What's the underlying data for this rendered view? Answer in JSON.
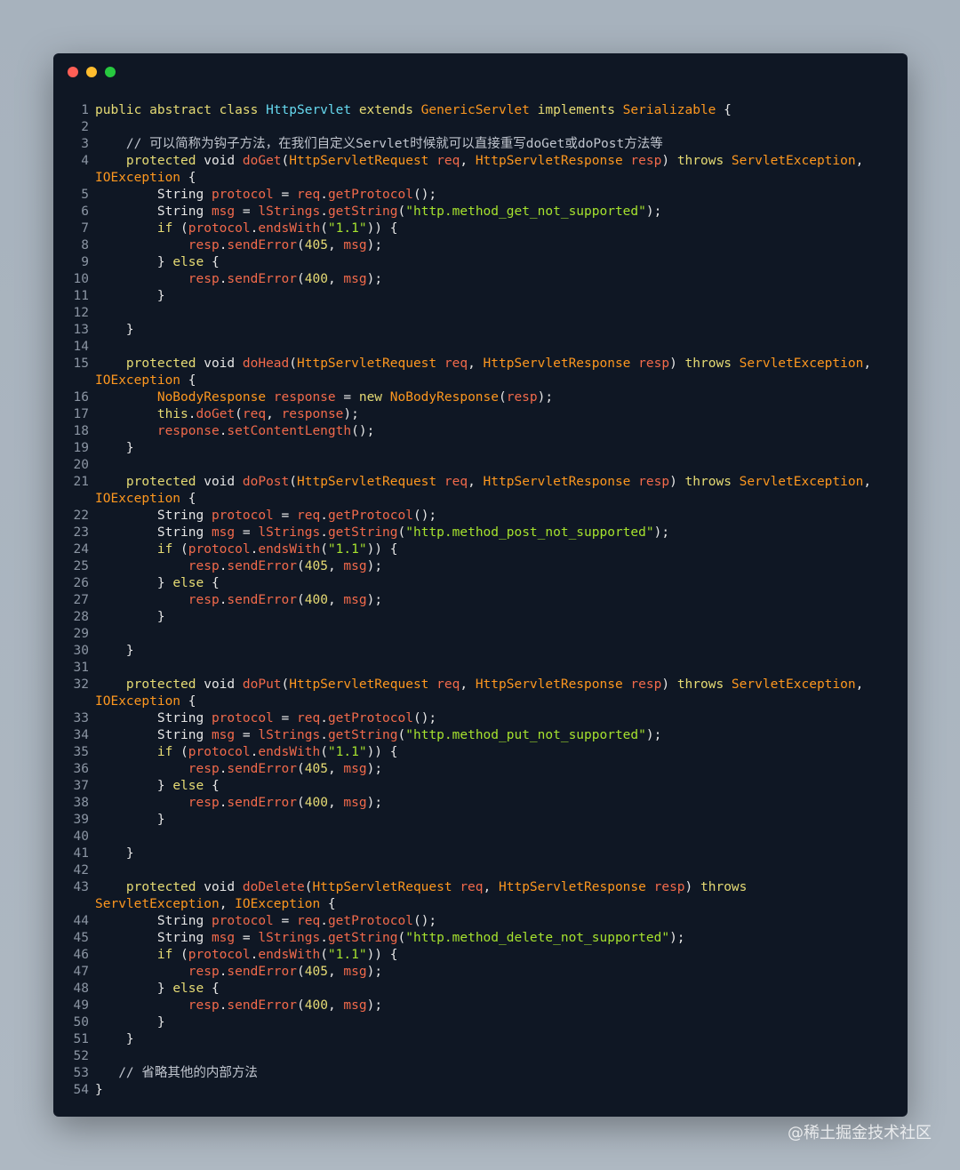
{
  "window": {
    "controls": [
      {
        "name": "close",
        "color": "#ff5f56"
      },
      {
        "name": "minimize",
        "color": "#ffbd2e"
      },
      {
        "name": "maximize",
        "color": "#27c93f"
      }
    ]
  },
  "watermark": "@稀土掘金技术社区",
  "colors": {
    "keyword": "#e6db74",
    "type": "#fd971f",
    "class": "#66d9ef",
    "identifier": "#f26a4b",
    "string": "#a6e22e",
    "comment": "#c0c5ce",
    "background": "#0f1724"
  },
  "lines": [
    {
      "n": "1",
      "t": [
        [
          "kw",
          "public abstract class "
        ],
        [
          "cls",
          "HttpServlet "
        ],
        [
          "kw",
          "extends "
        ],
        [
          "ty",
          "GenericServlet "
        ],
        [
          "kw",
          "implements "
        ],
        [
          "ty",
          "Serializable "
        ],
        [
          "pl",
          "{"
        ]
      ]
    },
    {
      "n": "2",
      "t": []
    },
    {
      "n": "3",
      "t": [
        [
          "cm",
          "    // 可以简称为钩子方法，在我们自定义Servlet时候就可以直接重写doGet或doPost方法等"
        ]
      ]
    },
    {
      "n": "4",
      "t": [
        [
          "kw",
          "    protected "
        ],
        [
          "pl",
          "void "
        ],
        [
          "fn",
          "doGet"
        ],
        [
          "pl",
          "("
        ],
        [
          "ty",
          "HttpServletRequest "
        ],
        [
          "var",
          "req"
        ],
        [
          "pl",
          ", "
        ],
        [
          "ty",
          "HttpServletResponse "
        ],
        [
          "var",
          "resp"
        ],
        [
          "pl",
          ") "
        ],
        [
          "kw",
          "throws "
        ],
        [
          "ty",
          "ServletException"
        ],
        [
          "pl",
          ","
        ]
      ]
    },
    {
      "n": "",
      "t": [
        [
          "ty",
          "IOException "
        ],
        [
          "pl",
          "{"
        ]
      ]
    },
    {
      "n": "5",
      "t": [
        [
          "pl",
          "        String "
        ],
        [
          "var",
          "protocol"
        ],
        [
          "pl",
          " = "
        ],
        [
          "var",
          "req"
        ],
        [
          "pl",
          "."
        ],
        [
          "fn",
          "getProtocol"
        ],
        [
          "pl",
          "();"
        ]
      ]
    },
    {
      "n": "6",
      "t": [
        [
          "pl",
          "        String "
        ],
        [
          "var",
          "msg"
        ],
        [
          "pl",
          " = "
        ],
        [
          "var",
          "lStrings"
        ],
        [
          "pl",
          "."
        ],
        [
          "fn",
          "getString"
        ],
        [
          "pl",
          "("
        ],
        [
          "str",
          "\"http.method_get_not_supported\""
        ],
        [
          "pl",
          ");"
        ]
      ]
    },
    {
      "n": "7",
      "t": [
        [
          "kw",
          "        if "
        ],
        [
          "pl",
          "("
        ],
        [
          "var",
          "protocol"
        ],
        [
          "pl",
          "."
        ],
        [
          "fn",
          "endsWith"
        ],
        [
          "pl",
          "("
        ],
        [
          "str",
          "\"1.1\""
        ],
        [
          "pl",
          ")) {"
        ]
      ]
    },
    {
      "n": "8",
      "t": [
        [
          "var",
          "            resp"
        ],
        [
          "pl",
          "."
        ],
        [
          "fn",
          "sendError"
        ],
        [
          "pl",
          "("
        ],
        [
          "num",
          "405"
        ],
        [
          "pl",
          ", "
        ],
        [
          "var",
          "msg"
        ],
        [
          "pl",
          ");"
        ]
      ]
    },
    {
      "n": "9",
      "t": [
        [
          "pl",
          "        } "
        ],
        [
          "kw",
          "else "
        ],
        [
          "pl",
          "{"
        ]
      ]
    },
    {
      "n": "10",
      "t": [
        [
          "var",
          "            resp"
        ],
        [
          "pl",
          "."
        ],
        [
          "fn",
          "sendError"
        ],
        [
          "pl",
          "("
        ],
        [
          "num",
          "400"
        ],
        [
          "pl",
          ", "
        ],
        [
          "var",
          "msg"
        ],
        [
          "pl",
          ");"
        ]
      ]
    },
    {
      "n": "11",
      "t": [
        [
          "pl",
          "        }"
        ]
      ]
    },
    {
      "n": "12",
      "t": []
    },
    {
      "n": "13",
      "t": [
        [
          "pl",
          "    }"
        ]
      ]
    },
    {
      "n": "14",
      "t": []
    },
    {
      "n": "15",
      "t": [
        [
          "kw",
          "    protected "
        ],
        [
          "pl",
          "void "
        ],
        [
          "fn",
          "doHead"
        ],
        [
          "pl",
          "("
        ],
        [
          "ty",
          "HttpServletRequest "
        ],
        [
          "var",
          "req"
        ],
        [
          "pl",
          ", "
        ],
        [
          "ty",
          "HttpServletResponse "
        ],
        [
          "var",
          "resp"
        ],
        [
          "pl",
          ") "
        ],
        [
          "kw",
          "throws "
        ],
        [
          "ty",
          "ServletException"
        ],
        [
          "pl",
          ","
        ]
      ]
    },
    {
      "n": "",
      "t": [
        [
          "ty",
          "IOException "
        ],
        [
          "pl",
          "{"
        ]
      ]
    },
    {
      "n": "16",
      "t": [
        [
          "ty",
          "        NoBodyResponse "
        ],
        [
          "var",
          "response"
        ],
        [
          "pl",
          " = "
        ],
        [
          "kw",
          "new "
        ],
        [
          "ty",
          "NoBodyResponse"
        ],
        [
          "pl",
          "("
        ],
        [
          "var",
          "resp"
        ],
        [
          "pl",
          ");"
        ]
      ]
    },
    {
      "n": "17",
      "t": [
        [
          "kw",
          "        this"
        ],
        [
          "pl",
          "."
        ],
        [
          "fn",
          "doGet"
        ],
        [
          "pl",
          "("
        ],
        [
          "var",
          "req"
        ],
        [
          "pl",
          ", "
        ],
        [
          "var",
          "response"
        ],
        [
          "pl",
          ");"
        ]
      ]
    },
    {
      "n": "18",
      "t": [
        [
          "var",
          "        response"
        ],
        [
          "pl",
          "."
        ],
        [
          "fn",
          "setContentLength"
        ],
        [
          "pl",
          "();"
        ]
      ]
    },
    {
      "n": "19",
      "t": [
        [
          "pl",
          "    }"
        ]
      ]
    },
    {
      "n": "20",
      "t": []
    },
    {
      "n": "21",
      "t": [
        [
          "kw",
          "    protected "
        ],
        [
          "pl",
          "void "
        ],
        [
          "fn",
          "doPost"
        ],
        [
          "pl",
          "("
        ],
        [
          "ty",
          "HttpServletRequest "
        ],
        [
          "var",
          "req"
        ],
        [
          "pl",
          ", "
        ],
        [
          "ty",
          "HttpServletResponse "
        ],
        [
          "var",
          "resp"
        ],
        [
          "pl",
          ") "
        ],
        [
          "kw",
          "throws "
        ],
        [
          "ty",
          "ServletException"
        ],
        [
          "pl",
          ","
        ]
      ]
    },
    {
      "n": "",
      "t": [
        [
          "ty",
          "IOException "
        ],
        [
          "pl",
          "{"
        ]
      ]
    },
    {
      "n": "22",
      "t": [
        [
          "pl",
          "        String "
        ],
        [
          "var",
          "protocol"
        ],
        [
          "pl",
          " = "
        ],
        [
          "var",
          "req"
        ],
        [
          "pl",
          "."
        ],
        [
          "fn",
          "getProtocol"
        ],
        [
          "pl",
          "();"
        ]
      ]
    },
    {
      "n": "23",
      "t": [
        [
          "pl",
          "        String "
        ],
        [
          "var",
          "msg"
        ],
        [
          "pl",
          " = "
        ],
        [
          "var",
          "lStrings"
        ],
        [
          "pl",
          "."
        ],
        [
          "fn",
          "getString"
        ],
        [
          "pl",
          "("
        ],
        [
          "str",
          "\"http.method_post_not_supported\""
        ],
        [
          "pl",
          ");"
        ]
      ]
    },
    {
      "n": "24",
      "t": [
        [
          "kw",
          "        if "
        ],
        [
          "pl",
          "("
        ],
        [
          "var",
          "protocol"
        ],
        [
          "pl",
          "."
        ],
        [
          "fn",
          "endsWith"
        ],
        [
          "pl",
          "("
        ],
        [
          "str",
          "\"1.1\""
        ],
        [
          "pl",
          ")) {"
        ]
      ]
    },
    {
      "n": "25",
      "t": [
        [
          "var",
          "            resp"
        ],
        [
          "pl",
          "."
        ],
        [
          "fn",
          "sendError"
        ],
        [
          "pl",
          "("
        ],
        [
          "num",
          "405"
        ],
        [
          "pl",
          ", "
        ],
        [
          "var",
          "msg"
        ],
        [
          "pl",
          ");"
        ]
      ]
    },
    {
      "n": "26",
      "t": [
        [
          "pl",
          "        } "
        ],
        [
          "kw",
          "else "
        ],
        [
          "pl",
          "{"
        ]
      ]
    },
    {
      "n": "27",
      "t": [
        [
          "var",
          "            resp"
        ],
        [
          "pl",
          "."
        ],
        [
          "fn",
          "sendError"
        ],
        [
          "pl",
          "("
        ],
        [
          "num",
          "400"
        ],
        [
          "pl",
          ", "
        ],
        [
          "var",
          "msg"
        ],
        [
          "pl",
          ");"
        ]
      ]
    },
    {
      "n": "28",
      "t": [
        [
          "pl",
          "        }"
        ]
      ]
    },
    {
      "n": "29",
      "t": []
    },
    {
      "n": "30",
      "t": [
        [
          "pl",
          "    }"
        ]
      ]
    },
    {
      "n": "31",
      "t": []
    },
    {
      "n": "32",
      "t": [
        [
          "kw",
          "    protected "
        ],
        [
          "pl",
          "void "
        ],
        [
          "fn",
          "doPut"
        ],
        [
          "pl",
          "("
        ],
        [
          "ty",
          "HttpServletRequest "
        ],
        [
          "var",
          "req"
        ],
        [
          "pl",
          ", "
        ],
        [
          "ty",
          "HttpServletResponse "
        ],
        [
          "var",
          "resp"
        ],
        [
          "pl",
          ") "
        ],
        [
          "kw",
          "throws "
        ],
        [
          "ty",
          "ServletException"
        ],
        [
          "pl",
          ","
        ]
      ]
    },
    {
      "n": "",
      "t": [
        [
          "ty",
          "IOException "
        ],
        [
          "pl",
          "{"
        ]
      ]
    },
    {
      "n": "33",
      "t": [
        [
          "pl",
          "        String "
        ],
        [
          "var",
          "protocol"
        ],
        [
          "pl",
          " = "
        ],
        [
          "var",
          "req"
        ],
        [
          "pl",
          "."
        ],
        [
          "fn",
          "getProtocol"
        ],
        [
          "pl",
          "();"
        ]
      ]
    },
    {
      "n": "34",
      "t": [
        [
          "pl",
          "        String "
        ],
        [
          "var",
          "msg"
        ],
        [
          "pl",
          " = "
        ],
        [
          "var",
          "lStrings"
        ],
        [
          "pl",
          "."
        ],
        [
          "fn",
          "getString"
        ],
        [
          "pl",
          "("
        ],
        [
          "str",
          "\"http.method_put_not_supported\""
        ],
        [
          "pl",
          ");"
        ]
      ]
    },
    {
      "n": "35",
      "t": [
        [
          "kw",
          "        if "
        ],
        [
          "pl",
          "("
        ],
        [
          "var",
          "protocol"
        ],
        [
          "pl",
          "."
        ],
        [
          "fn",
          "endsWith"
        ],
        [
          "pl",
          "("
        ],
        [
          "str",
          "\"1.1\""
        ],
        [
          "pl",
          ")) {"
        ]
      ]
    },
    {
      "n": "36",
      "t": [
        [
          "var",
          "            resp"
        ],
        [
          "pl",
          "."
        ],
        [
          "fn",
          "sendError"
        ],
        [
          "pl",
          "("
        ],
        [
          "num",
          "405"
        ],
        [
          "pl",
          ", "
        ],
        [
          "var",
          "msg"
        ],
        [
          "pl",
          ");"
        ]
      ]
    },
    {
      "n": "37",
      "t": [
        [
          "pl",
          "        } "
        ],
        [
          "kw",
          "else "
        ],
        [
          "pl",
          "{"
        ]
      ]
    },
    {
      "n": "38",
      "t": [
        [
          "var",
          "            resp"
        ],
        [
          "pl",
          "."
        ],
        [
          "fn",
          "sendError"
        ],
        [
          "pl",
          "("
        ],
        [
          "num",
          "400"
        ],
        [
          "pl",
          ", "
        ],
        [
          "var",
          "msg"
        ],
        [
          "pl",
          ");"
        ]
      ]
    },
    {
      "n": "39",
      "t": [
        [
          "pl",
          "        }"
        ]
      ]
    },
    {
      "n": "40",
      "t": []
    },
    {
      "n": "41",
      "t": [
        [
          "pl",
          "    }"
        ]
      ]
    },
    {
      "n": "42",
      "t": []
    },
    {
      "n": "43",
      "t": [
        [
          "kw",
          "    protected "
        ],
        [
          "pl",
          "void "
        ],
        [
          "fn",
          "doDelete"
        ],
        [
          "pl",
          "("
        ],
        [
          "ty",
          "HttpServletRequest "
        ],
        [
          "var",
          "req"
        ],
        [
          "pl",
          ", "
        ],
        [
          "ty",
          "HttpServletResponse "
        ],
        [
          "var",
          "resp"
        ],
        [
          "pl",
          ") "
        ],
        [
          "kw",
          "throws"
        ]
      ]
    },
    {
      "n": "",
      "t": [
        [
          "ty",
          "ServletException"
        ],
        [
          "pl",
          ", "
        ],
        [
          "ty",
          "IOException "
        ],
        [
          "pl",
          "{"
        ]
      ]
    },
    {
      "n": "44",
      "t": [
        [
          "pl",
          "        String "
        ],
        [
          "var",
          "protocol"
        ],
        [
          "pl",
          " = "
        ],
        [
          "var",
          "req"
        ],
        [
          "pl",
          "."
        ],
        [
          "fn",
          "getProtocol"
        ],
        [
          "pl",
          "();"
        ]
      ]
    },
    {
      "n": "45",
      "t": [
        [
          "pl",
          "        String "
        ],
        [
          "var",
          "msg"
        ],
        [
          "pl",
          " = "
        ],
        [
          "var",
          "lStrings"
        ],
        [
          "pl",
          "."
        ],
        [
          "fn",
          "getString"
        ],
        [
          "pl",
          "("
        ],
        [
          "str",
          "\"http.method_delete_not_supported\""
        ],
        [
          "pl",
          ");"
        ]
      ]
    },
    {
      "n": "46",
      "t": [
        [
          "kw",
          "        if "
        ],
        [
          "pl",
          "("
        ],
        [
          "var",
          "protocol"
        ],
        [
          "pl",
          "."
        ],
        [
          "fn",
          "endsWith"
        ],
        [
          "pl",
          "("
        ],
        [
          "str",
          "\"1.1\""
        ],
        [
          "pl",
          ")) {"
        ]
      ]
    },
    {
      "n": "47",
      "t": [
        [
          "var",
          "            resp"
        ],
        [
          "pl",
          "."
        ],
        [
          "fn",
          "sendError"
        ],
        [
          "pl",
          "("
        ],
        [
          "num",
          "405"
        ],
        [
          "pl",
          ", "
        ],
        [
          "var",
          "msg"
        ],
        [
          "pl",
          ");"
        ]
      ]
    },
    {
      "n": "48",
      "t": [
        [
          "pl",
          "        } "
        ],
        [
          "kw",
          "else "
        ],
        [
          "pl",
          "{"
        ]
      ]
    },
    {
      "n": "49",
      "t": [
        [
          "var",
          "            resp"
        ],
        [
          "pl",
          "."
        ],
        [
          "fn",
          "sendError"
        ],
        [
          "pl",
          "("
        ],
        [
          "num",
          "400"
        ],
        [
          "pl",
          ", "
        ],
        [
          "var",
          "msg"
        ],
        [
          "pl",
          ");"
        ]
      ]
    },
    {
      "n": "50",
      "t": [
        [
          "pl",
          "        }"
        ]
      ]
    },
    {
      "n": "51",
      "t": [
        [
          "pl",
          "    }"
        ]
      ]
    },
    {
      "n": "52",
      "t": []
    },
    {
      "n": "53",
      "t": [
        [
          "cm",
          "   // 省略其他的内部方法"
        ]
      ]
    },
    {
      "n": "54",
      "t": [
        [
          "pl",
          "}"
        ]
      ]
    }
  ]
}
